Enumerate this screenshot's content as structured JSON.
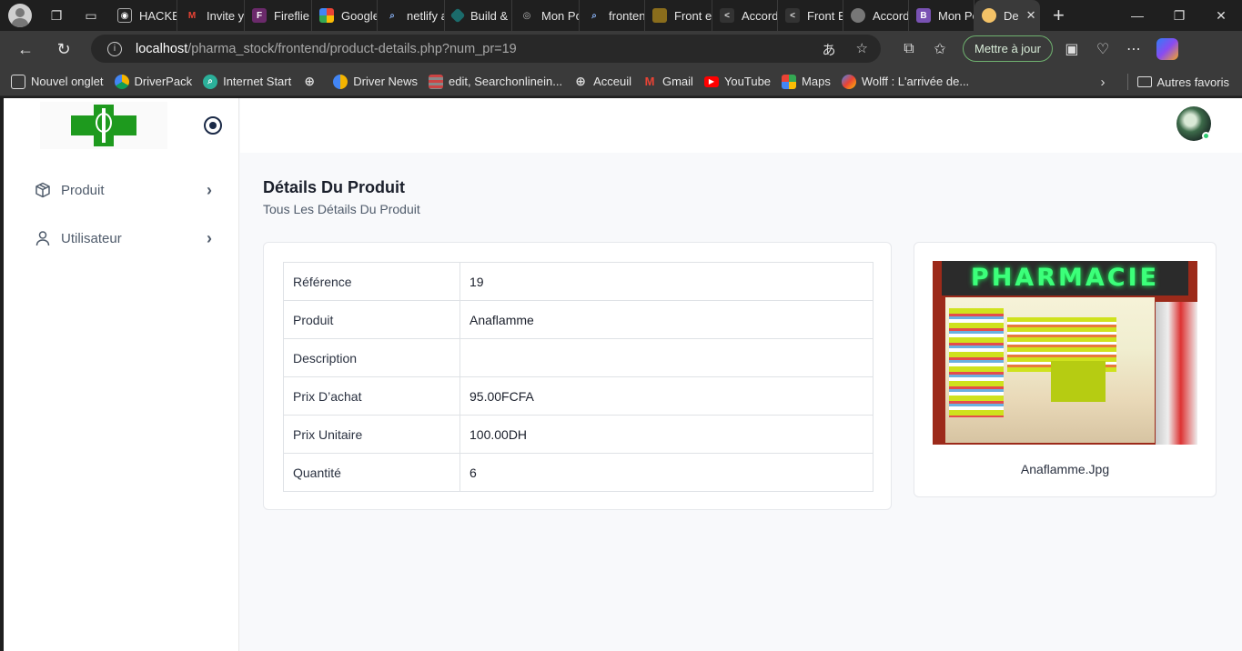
{
  "browser": {
    "tabs": [
      {
        "label": "HACKE",
        "icon": "github-icon"
      },
      {
        "label": "Invite y",
        "icon": "gmail-icon"
      },
      {
        "label": "Fireflie",
        "icon": "fireflies-icon"
      },
      {
        "label": "Google",
        "icon": "google-icon"
      },
      {
        "label": "netlify a",
        "icon": "search-icon"
      },
      {
        "label": "Build &",
        "icon": "diamond-icon"
      },
      {
        "label": "Mon Po",
        "icon": "globe-icon"
      },
      {
        "label": "fronten",
        "icon": "search-icon"
      },
      {
        "label": "Front e",
        "icon": "book-icon"
      },
      {
        "label": "Accord",
        "icon": "code-icon"
      },
      {
        "label": "Front E",
        "icon": "code-icon"
      },
      {
        "label": "Accord",
        "icon": "circle-icon"
      },
      {
        "label": "Mon Po",
        "icon": "bootstrap-icon"
      },
      {
        "label": "De",
        "icon": "app-icon",
        "active": true
      }
    ],
    "url_host": "localhost",
    "url_path": "/pharma_stock/frontend/product-details.php?num_pr=19",
    "update_button": "Mettre à jour",
    "bookmarks": [
      {
        "label": "Nouvel onglet",
        "icon": "newtab-icon"
      },
      {
        "label": "DriverPack",
        "icon": "driverpack-icon"
      },
      {
        "label": "Internet Start",
        "icon": "search-icon"
      },
      {
        "label": "",
        "icon": "globe-icon"
      },
      {
        "label": "Driver News",
        "icon": "driver-icon"
      },
      {
        "label": "edit, Searchonlinein...",
        "icon": "edit-icon"
      },
      {
        "label": "Acceuil",
        "icon": "globe-icon"
      },
      {
        "label": "Gmail",
        "icon": "gmail-icon"
      },
      {
        "label": "YouTube",
        "icon": "youtube-icon"
      },
      {
        "label": "Maps",
        "icon": "maps-icon"
      },
      {
        "label": "Wolff : L'arrivée de...",
        "icon": "butterfly-icon"
      }
    ],
    "other_favorites": "Autres favoris"
  },
  "sidebar": {
    "items": [
      {
        "label": "Produit"
      },
      {
        "label": "Utilisateur"
      }
    ]
  },
  "main": {
    "title": "Détails Du Produit",
    "subtitle": "Tous Les Détails Du Produit",
    "details": [
      {
        "key": "Référence",
        "value": "19"
      },
      {
        "key": "Produit",
        "value": "Anaflamme"
      },
      {
        "key": "Description",
        "value": ""
      },
      {
        "key": "Prix D’achat",
        "value": "95.00FCFA"
      },
      {
        "key": "Prix Unitaire",
        "value": "100.00DH"
      },
      {
        "key": "Quantité",
        "value": "6"
      }
    ],
    "image_sign": "PHARMACIE",
    "image_name": "Anaflamme.Jpg"
  },
  "colors": {
    "brand_green": "#1e9a1e",
    "online_dot": "#2ecc71"
  }
}
